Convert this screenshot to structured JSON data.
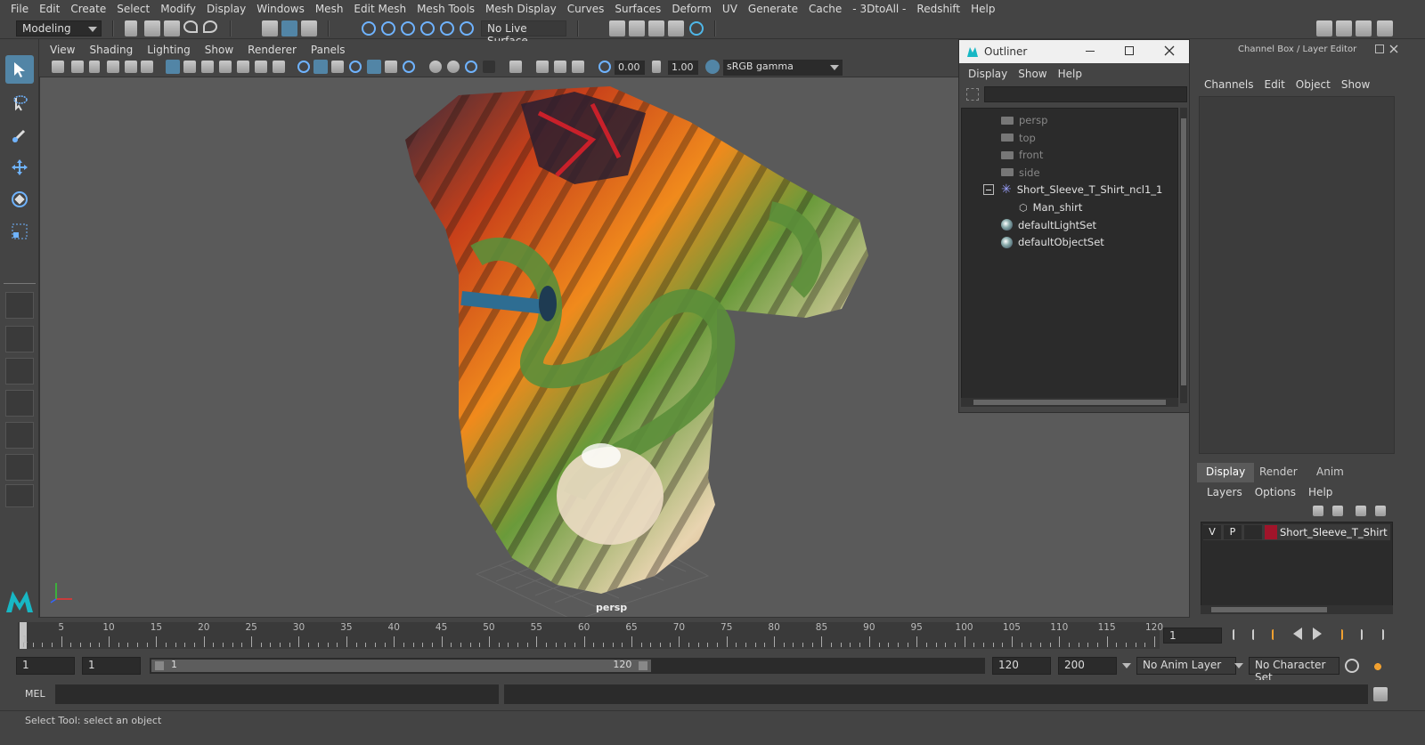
{
  "menubar": [
    "File",
    "Edit",
    "Create",
    "Select",
    "Modify",
    "Display",
    "Windows",
    "Mesh",
    "Edit Mesh",
    "Mesh Tools",
    "Mesh Display",
    "Curves",
    "Surfaces",
    "Deform",
    "UV",
    "Generate",
    "Cache",
    "- 3DtoAll -",
    "Redshift",
    "Help"
  ],
  "statusline": {
    "mode": "Modeling",
    "live_surface": "No Live Surface"
  },
  "viewport_menu": [
    "View",
    "Shading",
    "Lighting",
    "Show",
    "Renderer",
    "Panels"
  ],
  "viewport_toolbar": {
    "exposure": "0.00",
    "gamma": "1.00",
    "color_space": "sRGB gamma"
  },
  "viewport": {
    "camera_label": "persp"
  },
  "outliner": {
    "title": "Outliner",
    "menu": [
      "Display",
      "Show",
      "Help"
    ],
    "items": [
      {
        "label": "persp",
        "kind": "camera"
      },
      {
        "label": "top",
        "kind": "camera"
      },
      {
        "label": "front",
        "kind": "camera"
      },
      {
        "label": "side",
        "kind": "camera"
      },
      {
        "label": "Short_Sleeve_T_Shirt_ncl1_1",
        "kind": "group"
      },
      {
        "label": "Man_shirt",
        "kind": "mesh"
      },
      {
        "label": "defaultLightSet",
        "kind": "set"
      },
      {
        "label": "defaultObjectSet",
        "kind": "set"
      }
    ]
  },
  "channelbox": {
    "header": "Channel Box / Layer Editor",
    "menu": [
      "Channels",
      "Edit",
      "Object",
      "Show"
    ]
  },
  "layer_editor": {
    "tabs": [
      "Display",
      "Render",
      "Anim"
    ],
    "menu": [
      "Layers",
      "Options",
      "Help"
    ],
    "layer": {
      "v": "V",
      "p": "P",
      "name": "Short_Sleeve_T_Shirt",
      "color": "#a0142a"
    }
  },
  "timeline": {
    "labels": [
      "5",
      "10",
      "15",
      "20",
      "25",
      "30",
      "35",
      "40",
      "45",
      "50",
      "55",
      "60",
      "65",
      "70",
      "75",
      "80",
      "85",
      "90",
      "95",
      "100",
      "105",
      "110",
      "115",
      "120"
    ],
    "start_label": "1",
    "current_frame": "1"
  },
  "range": {
    "start": "1",
    "inner_start": "1",
    "slider_start": "1",
    "slider_end": "120",
    "end": "120",
    "outer_end": "200",
    "anim_layer": "No Anim Layer",
    "character_set": "No Character Set"
  },
  "cmdline": {
    "label": "MEL"
  },
  "help_line": "Select Tool: select an object"
}
